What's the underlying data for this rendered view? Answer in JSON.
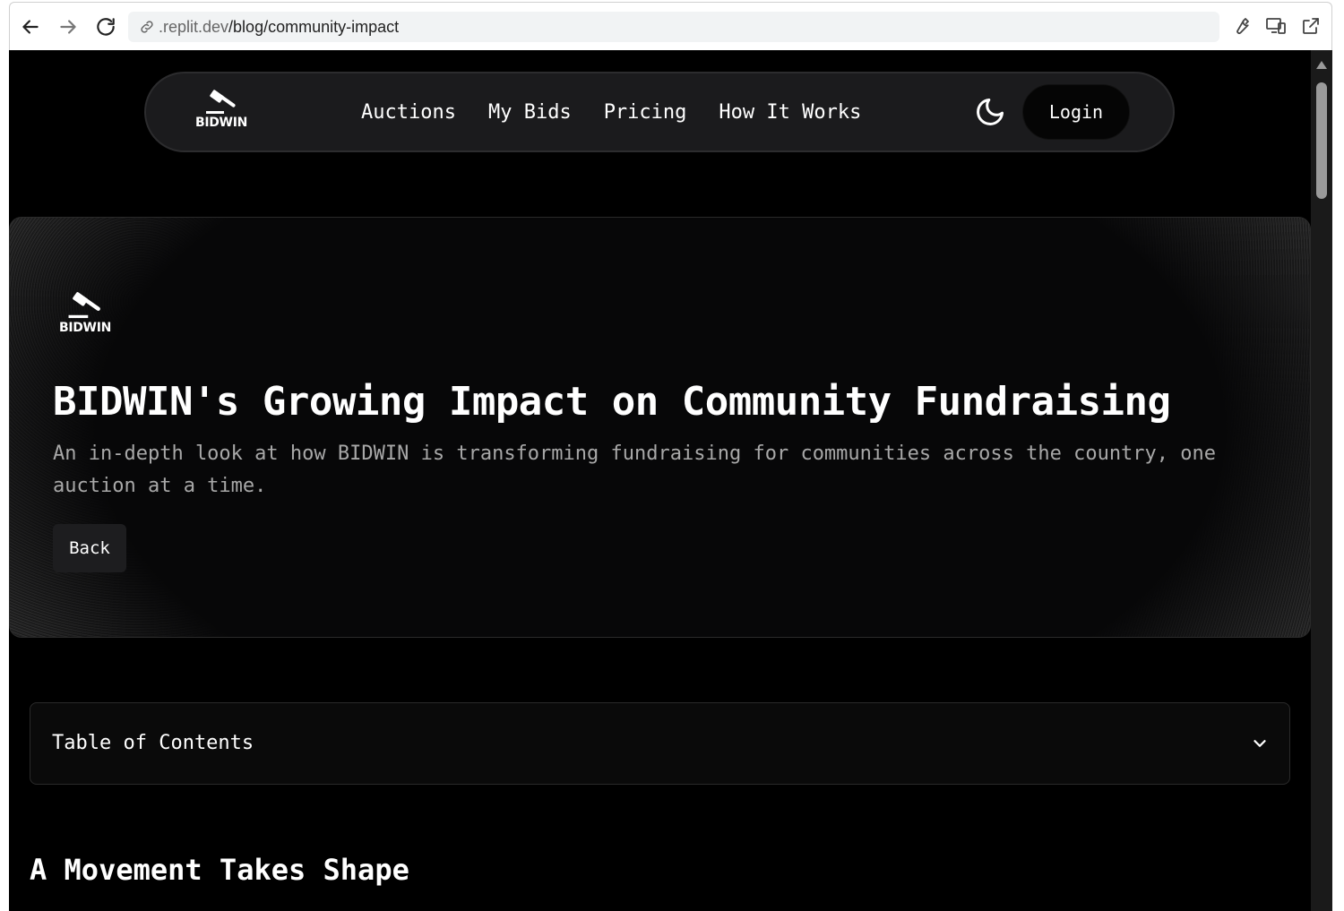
{
  "browser": {
    "url_host": ".replit.dev",
    "url_path": "/blog/community-impact"
  },
  "topnav": {
    "logo_text": "BIDWIN",
    "links": [
      "Auctions",
      "My Bids",
      "Pricing",
      "How It Works"
    ],
    "login_label": "Login"
  },
  "hero": {
    "logo_text": "BIDWIN",
    "title": "BIDWIN's Growing Impact on Community Fundraising",
    "subtitle": "An in-depth look at how BIDWIN is transforming fundraising for communities across the country, one auction at a time.",
    "back_label": "Back"
  },
  "toc": {
    "title": "Table of Contents"
  },
  "section": {
    "heading": "A Movement Takes Shape"
  }
}
